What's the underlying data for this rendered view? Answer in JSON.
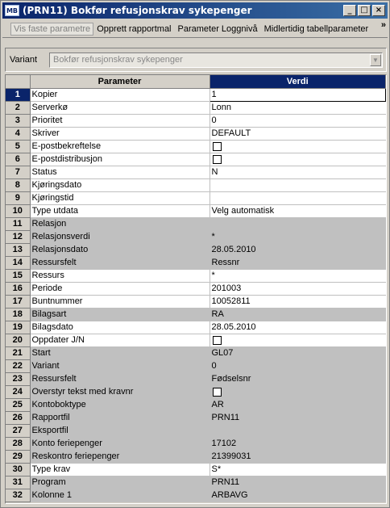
{
  "window": {
    "icon": "MB",
    "title": "(PRN11) Bokfør refusjonskrav sykepenger"
  },
  "menu": {
    "items": [
      "Vis faste parametre",
      "Opprett rapportmal",
      "Parameter Loggnivå",
      "Midlertidig tabellparameter"
    ],
    "more": "»"
  },
  "variant": {
    "label": "Variant",
    "value": "Bokfør refusjonskrav sykepenger"
  },
  "grid": {
    "headers": {
      "parameter": "Parameter",
      "value": "Verdi"
    },
    "rows": [
      {
        "num": "1",
        "param": "Kopier",
        "value": "1",
        "editable": true,
        "selected": true
      },
      {
        "num": "2",
        "param": "Serverkø",
        "value": "Lonn",
        "editable": true
      },
      {
        "num": "3",
        "param": "Prioritet",
        "value": "0",
        "editable": true
      },
      {
        "num": "4",
        "param": "Skriver",
        "value": "DEFAULT",
        "editable": true
      },
      {
        "num": "5",
        "param": "E-postbekreftelse",
        "value": "",
        "checkbox": true,
        "editable": true
      },
      {
        "num": "6",
        "param": "E-postdistribusjon",
        "value": "",
        "checkbox": true,
        "editable": true
      },
      {
        "num": "7",
        "param": "Status",
        "value": "N",
        "editable": true
      },
      {
        "num": "8",
        "param": "Kjøringsdato",
        "value": "",
        "editable": true
      },
      {
        "num": "9",
        "param": "Kjøringstid",
        "value": "",
        "editable": true
      },
      {
        "num": "10",
        "param": "Type utdata",
        "value": "Velg automatisk",
        "editable": true
      },
      {
        "num": "11",
        "param": "Relasjon",
        "value": "",
        "editable": false
      },
      {
        "num": "12",
        "param": "Relasjonsverdi",
        "value": "*",
        "editable": false
      },
      {
        "num": "13",
        "param": "Relasjonsdato",
        "value": "28.05.2010",
        "editable": false
      },
      {
        "num": "14",
        "param": "Ressursfelt",
        "value": "Ressnr",
        "editable": false
      },
      {
        "num": "15",
        "param": "Ressurs",
        "value": "*",
        "editable": true
      },
      {
        "num": "16",
        "param": "Periode",
        "value": "201003",
        "editable": true
      },
      {
        "num": "17",
        "param": "Buntnummer",
        "value": "10052811",
        "editable": true
      },
      {
        "num": "18",
        "param": "Bilagsart",
        "value": "RA",
        "editable": false
      },
      {
        "num": "19",
        "param": "Bilagsdato",
        "value": "28.05.2010",
        "editable": true
      },
      {
        "num": "20",
        "param": "Oppdater J/N",
        "value": "",
        "checkbox": true,
        "editable": true
      },
      {
        "num": "21",
        "param": "Start",
        "value": "GL07",
        "editable": false
      },
      {
        "num": "22",
        "param": "Variant",
        "value": "0",
        "editable": false
      },
      {
        "num": "23",
        "param": "Ressursfelt",
        "value": "Fødselsnr",
        "editable": false
      },
      {
        "num": "24",
        "param": "Overstyr tekst med kravnr",
        "value": "",
        "checkbox": true,
        "editable": false
      },
      {
        "num": "25",
        "param": "Kontoboktype",
        "value": "AR",
        "editable": false
      },
      {
        "num": "26",
        "param": "Rapportfil",
        "value": "PRN11",
        "editable": false
      },
      {
        "num": "27",
        "param": "Eksportfil",
        "value": "",
        "editable": false
      },
      {
        "num": "28",
        "param": "Konto feriepenger",
        "value": "17102",
        "editable": false
      },
      {
        "num": "29",
        "param": "Reskontro feriepenger",
        "value": "21399031",
        "editable": false
      },
      {
        "num": "30",
        "param": "Type krav",
        "value": "S*",
        "editable": true
      },
      {
        "num": "31",
        "param": "Program",
        "value": "PRN11",
        "editable": false
      },
      {
        "num": "32",
        "param": "Kolonne 1",
        "value": "ARBAVG",
        "editable": false
      }
    ]
  }
}
